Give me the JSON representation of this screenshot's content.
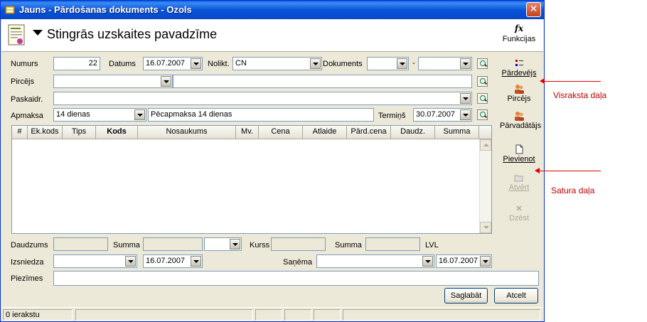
{
  "window": {
    "title": "Jauns - Pārdošanas dokuments - Ozols",
    "close_glyph": "✕"
  },
  "header": {
    "title": "Stingrās uzskaites pavadzīme",
    "functions_label": "Funkcijas",
    "functions_icon_text": "fx"
  },
  "form": {
    "numurs_label": "Numurs",
    "numurs_value": "22",
    "datums_label": "Datums",
    "datums_value": "16.07.2007",
    "noliktava_label": "Nolikt.",
    "noliktava_value": "CN",
    "dokuments_label": "Dokuments",
    "dokuments_value": "",
    "dokuments_sep": "-",
    "dokuments_value2": "",
    "pircejs_label": "Pircējs",
    "pircejs_value": "",
    "pircejs_name": "",
    "paskaidr_label": "Paskaidr.",
    "paskaidr_value": "",
    "apmaksa_label": "Apmaksa",
    "apmaksa_value": "14 dienas",
    "apmaksa_desc": "Pēcapmaksa 14 dienas",
    "termins_label": "Termiņš",
    "termins_value": "30.07.2007"
  },
  "grid": {
    "columns": [
      "#",
      "Ek.kods",
      "Tips",
      "Kods",
      "Nosaukums",
      "Mv.",
      "Cena",
      "Atlaide",
      "Pārd.cena",
      "Daudz.",
      "Summa"
    ],
    "rows": []
  },
  "totals": {
    "daudzums_label": "Daudzums",
    "daudzums_value": "",
    "summa_label": "Summa",
    "summa_value": "",
    "currency_select": "",
    "kurss_label": "Kurss",
    "kurss_value": "",
    "summa2_label": "Summa",
    "summa2_value": "",
    "currency": "LVL"
  },
  "bottom": {
    "izsniedza_label": "Izsniedza",
    "izsniedza_value": "",
    "izsniedza_date": "16.07.2007",
    "sanema_label": "Saņēma",
    "sanema_value": "",
    "sanema_date": "16.07.2007",
    "piezimes_label": "Piezīmes",
    "piezimes_value": ""
  },
  "side": {
    "pardevejs": "Pārdevējs",
    "pircejs": "Pircējs",
    "parvadatajs": "Pārvadātājs",
    "pievienot": "Pievienot",
    "atvert": "Atvērt",
    "dzest": "Dzēst"
  },
  "buttons": {
    "save": "Saglabāt",
    "cancel": "Atcelt"
  },
  "status": {
    "records": "0 ierakstu"
  },
  "annotations": {
    "header_part": "Visraksta daļa",
    "content_part": "Satura daļa"
  },
  "colors": {
    "titlebar": "#0a54d8",
    "window_bg": "#ece9d8",
    "annotation": "#c00000"
  }
}
